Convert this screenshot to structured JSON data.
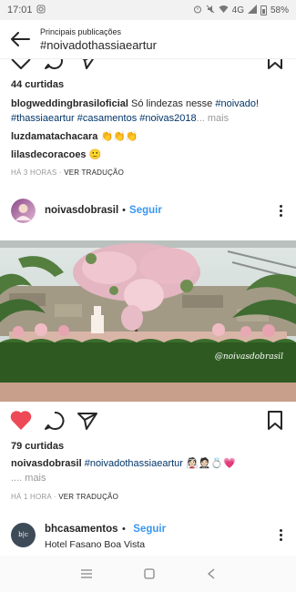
{
  "status_bar": {
    "time": "17:01",
    "network": "4G",
    "battery": "58%"
  },
  "header": {
    "subtitle": "Principais publicações",
    "title": "#noivadothassiaeartur"
  },
  "post1": {
    "likes": "44 curtidas",
    "caption_user": "blogweddingbrasiloficial",
    "caption_text": " Só lindezas nesse ",
    "caption_tag1": "#noivado!",
    "caption_tags2": "#thassiaeartur #casamentos #noivas2018",
    "caption_more": "... mais",
    "comment1_user": "luzdamatachacara",
    "comment1_text": " 👏👏👏",
    "comment2_user": "lilasdecoracoes",
    "comment2_text": " 🙂",
    "time": "HÁ 3 HORAS",
    "translate": "VER TRADUÇÃO"
  },
  "post2": {
    "username": "noivasdobrasil",
    "follow": "Seguir",
    "watermark": "@noivasdobrasil",
    "likes": "79 curtidas",
    "caption_user": "noivasdobrasil",
    "caption_tag": "#noivadothassiaeartur",
    "caption_emoji": " 👰🏻🤵🏻💍💗",
    "caption_more": ".... mais",
    "time": "HÁ 1 HORA",
    "translate": "VER TRADUÇÃO"
  },
  "post3": {
    "username": "bhcasamentos",
    "follow": "Seguir",
    "location": "Hotel Fasano Boa Vista",
    "avatar_text": "b|c"
  },
  "colors": {
    "like_red": "#ed4956",
    "link_blue": "#3897f0",
    "hashtag": "#003569"
  },
  "icons": [
    "back-arrow-icon",
    "heart-icon",
    "comment-icon",
    "share-icon",
    "bookmark-icon",
    "more-icon",
    "menu-icon",
    "home-square-icon",
    "back-nav-icon"
  ]
}
